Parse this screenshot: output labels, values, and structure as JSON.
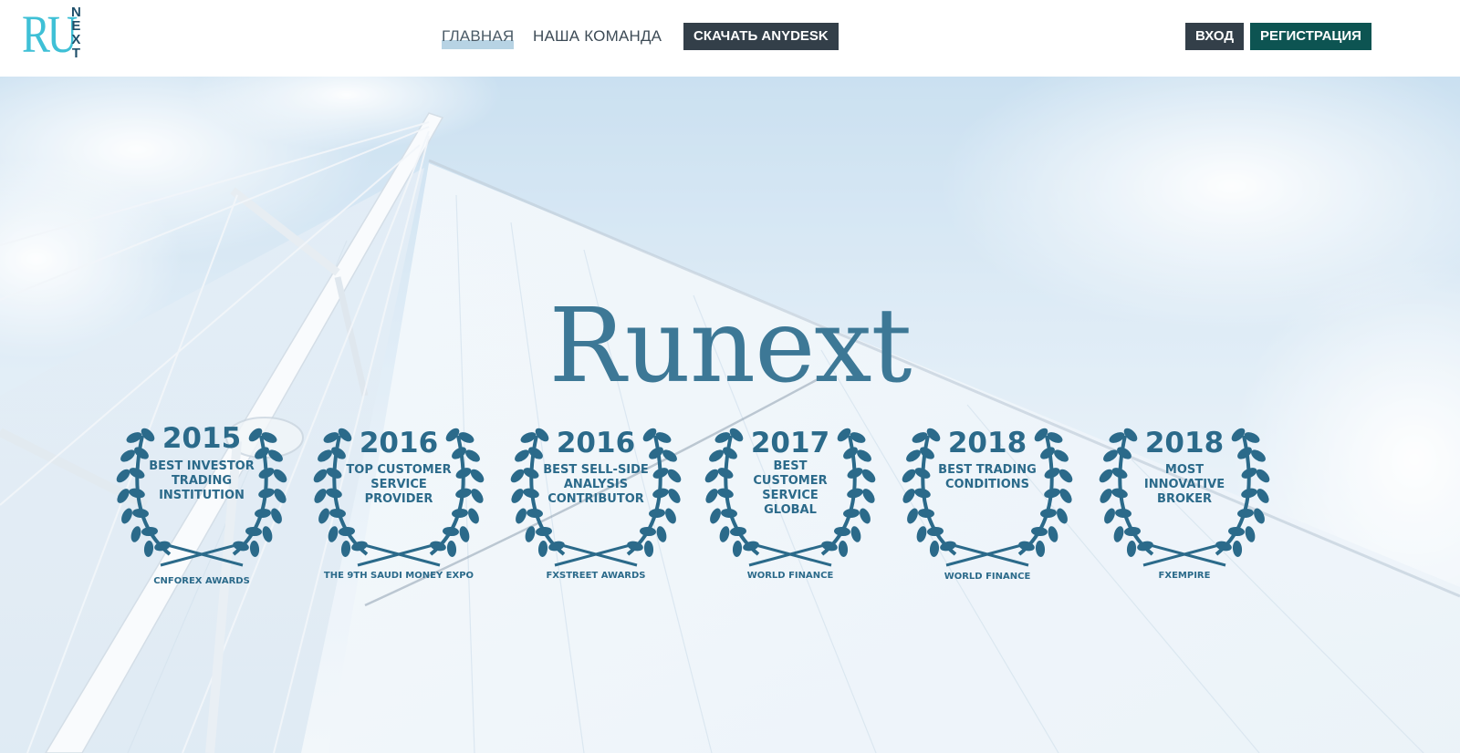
{
  "logo": {
    "primary": "RU",
    "secondary": [
      "N",
      "E",
      "X",
      "T"
    ],
    "colors": {
      "ru": "#3fc0d6",
      "next": "#1f4f6a"
    }
  },
  "nav": {
    "items": [
      {
        "label": "ГЛАВНАЯ",
        "active": true
      },
      {
        "label": "НАША КОМАНДА",
        "active": false
      }
    ],
    "download_label": "СКАЧАТЬ ANYDESK"
  },
  "auth": {
    "login_label": "ВХОД",
    "register_label": "РЕГИСТРАЦИЯ"
  },
  "hero": {
    "title": "Runext",
    "awards": [
      {
        "year": "2015",
        "text": "BEST INVESTOR TRADING INSTITUTION",
        "source": "CNFOREX AWARDS"
      },
      {
        "year": "2016",
        "text": "TOP CUSTOMER SERVICE PROVIDER",
        "source": "THE 9TH SAUDI MONEY EXPO"
      },
      {
        "year": "2016",
        "text": "BEST SELL-SIDE ANALYSIS CONTRIBUTOR",
        "source": "FXSTREET AWARDS"
      },
      {
        "year": "2017",
        "text": "BEST CUSTOMER SERVICE GLOBAL",
        "source": "WORLD FINANCE"
      },
      {
        "year": "2018",
        "text": "BEST TRADING CONDITIONS",
        "source": "WORLD FINANCE"
      },
      {
        "year": "2018",
        "text": "MOST INNOVATIVE BROKER",
        "source": "FXEMPIRE"
      }
    ]
  },
  "colors": {
    "title": "#3d7896",
    "award": "#2b6a8a",
    "button_dark": "#333f49",
    "button_teal": "#0d5452",
    "nav_highlight": "#b7d3e4"
  }
}
